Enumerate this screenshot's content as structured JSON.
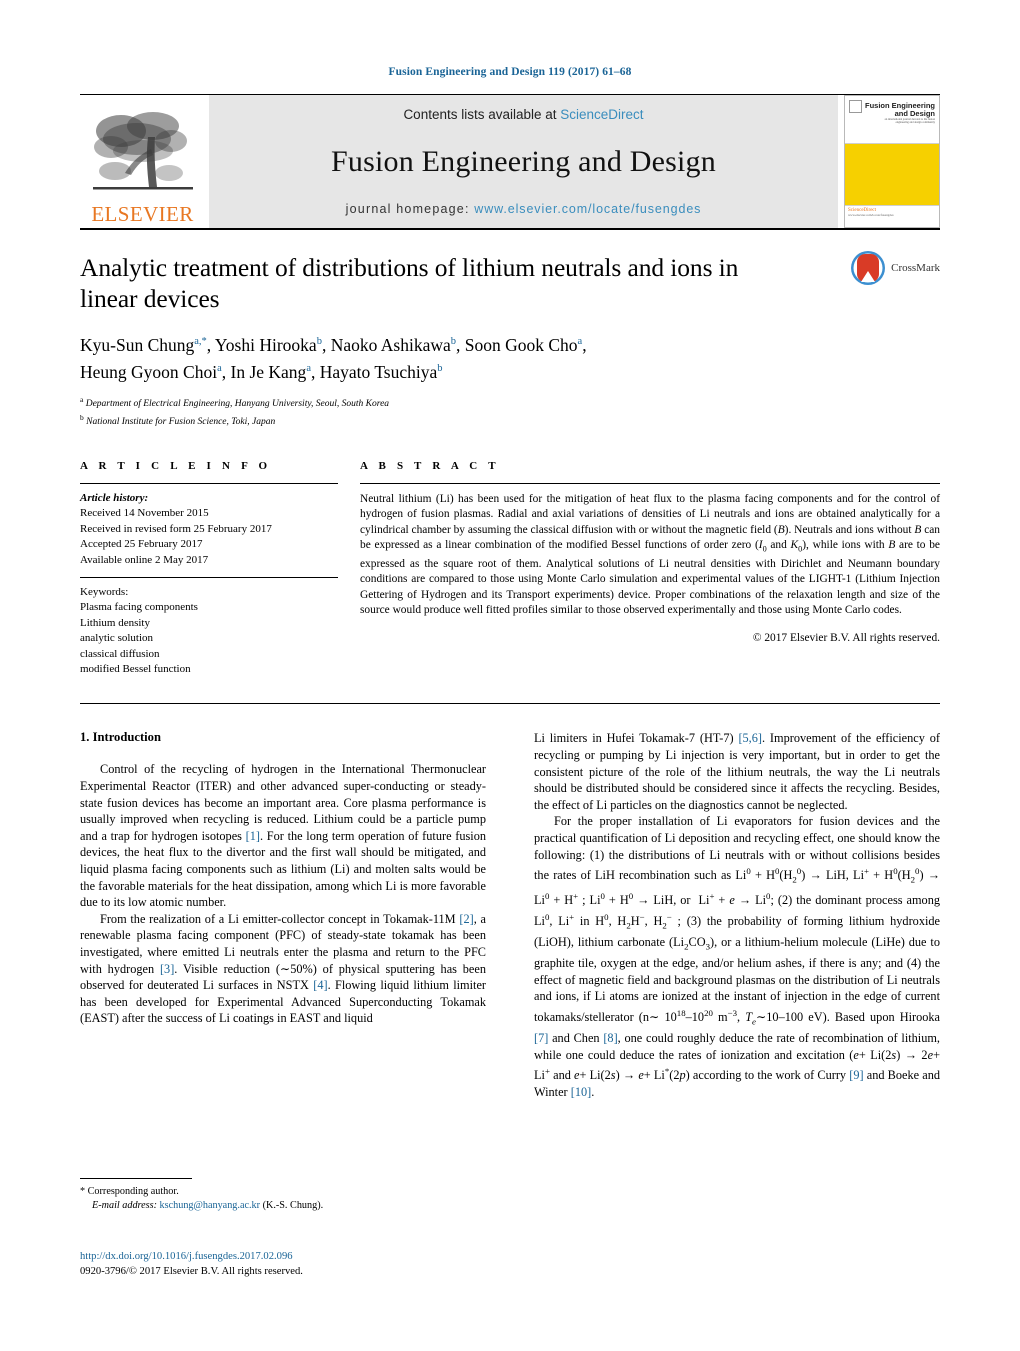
{
  "running_head": "Fusion Engineering and Design 119 (2017) 61–68",
  "masthead": {
    "contents_prefix": "Contents lists available at ",
    "contents_link": "ScienceDirect",
    "journal_title": "Fusion Engineering and Design",
    "homepage_prefix": "journal homepage: ",
    "homepage_url": "www.elsevier.com/locate/fusengdes",
    "publisher_logo_text": "ELSEVIER",
    "cover_title_line1": "Fusion Engineering",
    "cover_title_line2": "and Design",
    "cover_sub": "an international journal devoted to the fusion engineering and design community",
    "cover_footer": "ScienceDirect",
    "cover_footer_url": "www.elsevier.com/locate/fusengdes",
    "accent_link_color": "#3a8dbd",
    "cover_yellow": "#f6d000",
    "elsevier_orange": "#e87722"
  },
  "article": {
    "title": "Analytic treatment of distributions of lithium neutrals and ions in linear devices",
    "crossmark_label": "CrossMark",
    "authors_line1": "Kyu-Sun Chung",
    "authors": [
      {
        "name": "Kyu-Sun Chung",
        "sup": "a,*"
      },
      {
        "name": "Yoshi Hirooka",
        "sup": "b"
      },
      {
        "name": "Naoko Ashikawa",
        "sup": "b"
      },
      {
        "name": "Soon Gook Cho",
        "sup": "a"
      },
      {
        "name": "Heung Gyoon Choi",
        "sup": "a"
      },
      {
        "name": "In Je Kang",
        "sup": "a"
      },
      {
        "name": "Hayato Tsuchiya",
        "sup": "b"
      }
    ],
    "affiliations": [
      {
        "mark": "a",
        "text": "Department of Electrical Engineering, Hanyang University, Seoul, South Korea"
      },
      {
        "mark": "b",
        "text": "National Institute for Fusion Science, Toki, Japan"
      }
    ]
  },
  "article_info": {
    "heading": "A R T I C L E   I N F O",
    "history_label": "Article history:",
    "history": [
      "Received 14 November 2015",
      "Received in revised form 25 February 2017",
      "Accepted 25 February 2017",
      "Available online 2 May 2017"
    ],
    "keywords_label": "Keywords:",
    "keywords": [
      "Plasma facing components",
      "Lithium density",
      "analytic solution",
      "classical diffusion",
      "modified Bessel function"
    ]
  },
  "abstract": {
    "heading": "A B S T R A C T",
    "text": "Neutral lithium (Li) has been used for the mitigation of heat flux to the plasma facing components and for the control of hydrogen of fusion plasmas. Radial and axial variations of densities of Li neutrals and ions are obtained analytically for a cylindrical chamber by assuming the classical diffusion with or without the magnetic field (B). Neutrals and ions without B can be expressed as a linear combination of the modified Bessel functions of order zero (I₀ and K₀), while ions with B are to be expressed as the square root of them. Analytical solutions of Li neutral densities with Dirichlet and Neumann boundary conditions are compared to those using Monte Carlo simulation and experimental values of the LIGHT-1 (Lithium Injection Gettering of Hydrogen and its Transport experiments) device. Proper combinations of the relaxation length and size of the source would produce well fitted profiles similar to those observed experimentally and those using Monte Carlo codes.",
    "copyright": "© 2017 Elsevier B.V. All rights reserved."
  },
  "introduction": {
    "heading": "1.  Introduction",
    "left_paragraphs": [
      "Control of the recycling of hydrogen in the International Thermonuclear Experimental Reactor (ITER) and other advanced super-conducting or steady-state fusion devices has become an important area. Core plasma performance is usually improved when recycling is reduced. Lithium could be a particle pump and a trap for hydrogen isotopes [1]. For the long term operation of future fusion devices, the heat flux to the divertor and the first wall should be mitigated, and liquid plasma facing components such as lithium (Li) and molten salts would be the favorable materials for the heat dissipation, among which Li is more favorable due to its low atomic number.",
      "From the realization of a Li emitter-collector concept in Tokamak-11M [2], a renewable plasma facing component (PFC) of steady-state tokamak has been investigated, where emitted Li neutrals enter the plasma and return to the PFC with hydrogen [3]. Visible reduction (∼50%) of physical sputtering has been observed for deuterated Li surfaces in NSTX [4]. Flowing liquid lithium limiter has been developed for Experimental Advanced Superconducting Tokamak (EAST) after the success of Li coatings in EAST and liquid"
    ],
    "right_paragraphs": [
      "Li limiters in Hufei Tokamak-7 (HT-7) [5,6]. Improvement of the efficiency of recycling or pumping by Li injection is very important, but in order to get the consistent picture of the role of the lithium neutrals, the way the Li neutrals should be distributed should be considered since it affects the recycling. Besides, the effect of Li particles on the diagnostics cannot be neglected."
    ]
  },
  "footnote": {
    "corresponding": "*  Corresponding author.",
    "email_label": "E-mail address:",
    "email": "kschung@hanyang.ac.kr",
    "email_suffix": "(K.-S. Chung)."
  },
  "doi": {
    "url": "http://dx.doi.org/10.1016/j.fusengdes.2017.02.096",
    "issn_line": "0920-3796/© 2017 Elsevier B.V. All rights reserved."
  }
}
